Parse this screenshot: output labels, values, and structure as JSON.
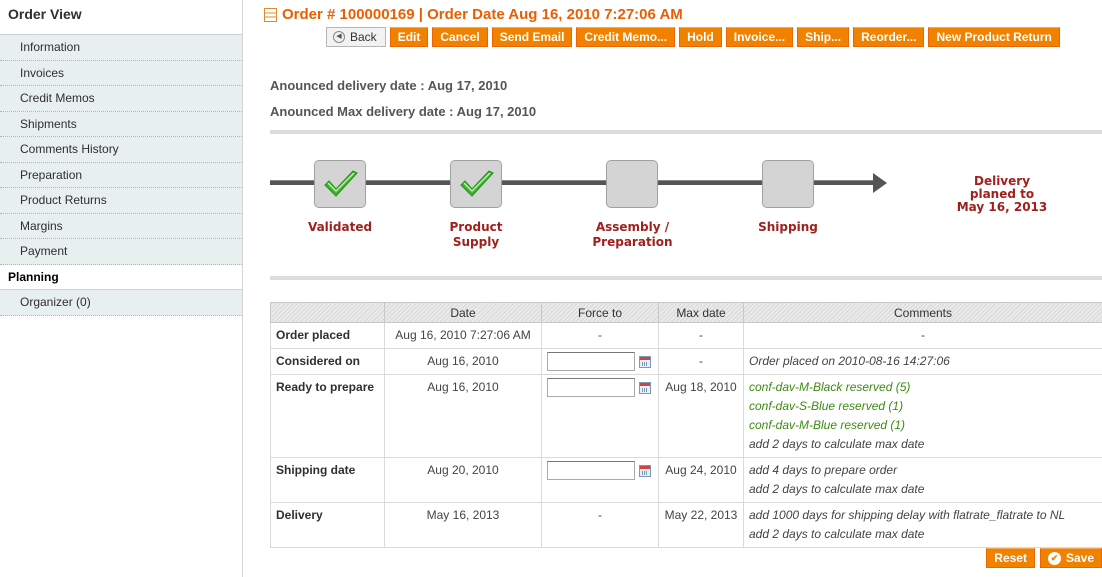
{
  "sidebar": {
    "title": "Order View",
    "items": [
      {
        "label": "Information"
      },
      {
        "label": "Invoices"
      },
      {
        "label": "Credit Memos"
      },
      {
        "label": "Shipments"
      },
      {
        "label": "Comments History"
      },
      {
        "label": "Preparation"
      },
      {
        "label": "Product Returns"
      },
      {
        "label": "Margins"
      },
      {
        "label": "Payment"
      },
      {
        "label": "Planning"
      },
      {
        "label": "Organizer (0)"
      }
    ],
    "active": "Planning"
  },
  "header": {
    "title": "Order # 100000169 | Order Date Aug 16, 2010 7:27:06 AM"
  },
  "toolbar": {
    "back": "Back",
    "edit": "Edit",
    "cancel": "Cancel",
    "send_email": "Send Email",
    "credit_memo": "Credit Memo...",
    "hold": "Hold",
    "invoice": "Invoice...",
    "ship": "Ship...",
    "reorder": "Reorder...",
    "new_product_return": "New Product Return"
  },
  "announced": {
    "delivery": "Anounced delivery date : Aug 17, 2010",
    "max_delivery": "Anounced Max delivery date : Aug 17, 2010"
  },
  "timeline": {
    "steps": [
      {
        "label_line1": "Validated",
        "label_line2": "",
        "done": true
      },
      {
        "label_line1": "Product",
        "label_line2": "Supply",
        "done": true
      },
      {
        "label_line1": "Assembly /",
        "label_line2": "Preparation",
        "done": false
      },
      {
        "label_line1": "Shipping",
        "label_line2": "",
        "done": false
      }
    ],
    "delivery_line1": "Delivery",
    "delivery_line2": "planed to",
    "delivery_line3": "May 16, 2013"
  },
  "table": {
    "headers": [
      "",
      "Date",
      "Force to",
      "Max date",
      "Comments"
    ],
    "rows": [
      {
        "label": "Order placed",
        "date": "Aug 16, 2010 7:27:06 AM",
        "force": "-",
        "max": "-",
        "comments": [
          "-"
        ]
      },
      {
        "label": "Considered on",
        "date": "Aug 16, 2010",
        "force": "",
        "max": "-",
        "comments": [
          "Order placed on 2010-08-16 14:27:06"
        ]
      },
      {
        "label": "Ready to prepare",
        "date": "Aug 16, 2010",
        "force": "",
        "max": "Aug 18, 2010",
        "comments": [
          "conf-dav-M-Black reserved (5)",
          "conf-dav-S-Blue reserved (1)",
          "conf-dav-M-Blue reserved (1)",
          "add 2 days to calculate max date"
        ]
      },
      {
        "label": "Shipping date",
        "date": "Aug 20, 2010",
        "force": "",
        "max": "Aug 24, 2010",
        "comments": [
          "add 4 days to prepare order",
          "add 2 days to calculate max date"
        ]
      },
      {
        "label": "Delivery",
        "date": "May 16, 2013",
        "force": "-",
        "max": "May 22, 2013",
        "comments": [
          "add 1000 days for shipping delay with flatrate_flatrate to NL",
          "add 2 days to calculate max date"
        ]
      }
    ]
  },
  "bottom": {
    "reset": "Reset",
    "save": "Save"
  },
  "colors": {
    "accent": "#f18200",
    "title": "#eb5e00",
    "step_label": "#a0201d",
    "reserved_green": "#3d8b13"
  }
}
